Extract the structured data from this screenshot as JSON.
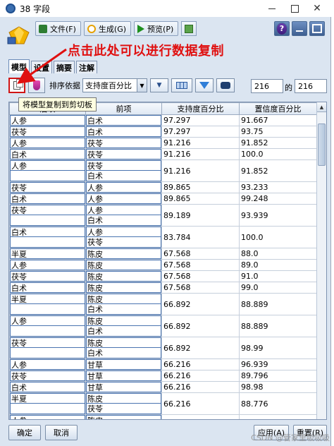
{
  "window": {
    "title": "38 字段"
  },
  "menu": {
    "file": "文件(F)",
    "generate": "生成(G)",
    "preview": "预览(P)"
  },
  "annotation": "点击此处可以进行数据复制",
  "tabs": [
    {
      "label": "模型",
      "active": true
    },
    {
      "label": "设置"
    },
    {
      "label": "摘要"
    },
    {
      "label": "注解"
    }
  ],
  "toolbar": {
    "sort_label": "排序依据",
    "sort_value": "支持度百分比",
    "range_from": "216",
    "range_of": "的",
    "range_to": "216"
  },
  "tooltip": "将模型复制到剪切板",
  "table": {
    "headers": [
      "后项",
      "前项",
      "支持度百分比",
      "置信度百分比"
    ],
    "rows": [
      {
        "consequent": [
          "人参"
        ],
        "antecedent": [
          "白术"
        ],
        "support": "97.297",
        "confidence": "91.667"
      },
      {
        "consequent": [
          "茯苓"
        ],
        "antecedent": [
          "白术"
        ],
        "support": "97.297",
        "confidence": "93.75"
      },
      {
        "consequent": [
          "人参"
        ],
        "antecedent": [
          "茯苓"
        ],
        "support": "91.216",
        "confidence": "91.852"
      },
      {
        "consequent": [
          "白术"
        ],
        "antecedent": [
          "茯苓"
        ],
        "support": "91.216",
        "confidence": "100.0"
      },
      {
        "consequent": [
          "人参"
        ],
        "antecedent": [
          "茯苓",
          "白术"
        ],
        "support": "91.216",
        "confidence": "91.852"
      },
      {
        "consequent": [
          "茯苓"
        ],
        "antecedent": [
          "人参"
        ],
        "support": "89.865",
        "confidence": "93.233"
      },
      {
        "consequent": [
          "白术"
        ],
        "antecedent": [
          "人参"
        ],
        "support": "89.865",
        "confidence": "99.248"
      },
      {
        "consequent": [
          "茯苓"
        ],
        "antecedent": [
          "人参",
          "白术"
        ],
        "support": "89.189",
        "confidence": "93.939"
      },
      {
        "consequent": [
          "白术"
        ],
        "antecedent": [
          "人参",
          "茯苓"
        ],
        "support": "83.784",
        "confidence": "100.0"
      },
      {
        "consequent": [
          "半夏"
        ],
        "antecedent": [
          "陈皮"
        ],
        "support": "67.568",
        "confidence": "88.0"
      },
      {
        "consequent": [
          "人参"
        ],
        "antecedent": [
          "陈皮"
        ],
        "support": "67.568",
        "confidence": "89.0"
      },
      {
        "consequent": [
          "茯苓"
        ],
        "antecedent": [
          "陈皮"
        ],
        "support": "67.568",
        "confidence": "91.0"
      },
      {
        "consequent": [
          "白术"
        ],
        "antecedent": [
          "陈皮"
        ],
        "support": "67.568",
        "confidence": "99.0"
      },
      {
        "consequent": [
          "半夏"
        ],
        "antecedent": [
          "陈皮",
          "白术"
        ],
        "support": "66.892",
        "confidence": "88.889"
      },
      {
        "consequent": [
          "人参"
        ],
        "antecedent": [
          "陈皮",
          "白术"
        ],
        "support": "66.892",
        "confidence": "88.889"
      },
      {
        "consequent": [
          "茯苓"
        ],
        "antecedent": [
          "陈皮",
          "白术"
        ],
        "support": "66.892",
        "confidence": "98.99"
      },
      {
        "consequent": [
          "人参"
        ],
        "antecedent": [
          "甘草"
        ],
        "support": "66.216",
        "confidence": "96.939"
      },
      {
        "consequent": [
          "茯苓"
        ],
        "antecedent": [
          "甘草"
        ],
        "support": "66.216",
        "confidence": "89.796"
      },
      {
        "consequent": [
          "白术"
        ],
        "antecedent": [
          "甘草"
        ],
        "support": "66.216",
        "confidence": "98.98"
      },
      {
        "consequent": [
          "半夏"
        ],
        "antecedent": [
          "陈皮",
          "茯苓"
        ],
        "support": "66.216",
        "confidence": "88.776"
      },
      {
        "consequent": [
          "人参"
        ],
        "antecedent": [
          "陈皮"
        ],
        "support": "",
        "confidence": ""
      }
    ]
  },
  "buttons": {
    "ok": "确定",
    "cancel": "取消",
    "apply": "应用(A)",
    "reset": "重置(R)"
  },
  "watermark": "CSDN @管家里吸吸吸",
  "colors": {
    "annotation": "#e01010",
    "highlight": "#d01515"
  }
}
